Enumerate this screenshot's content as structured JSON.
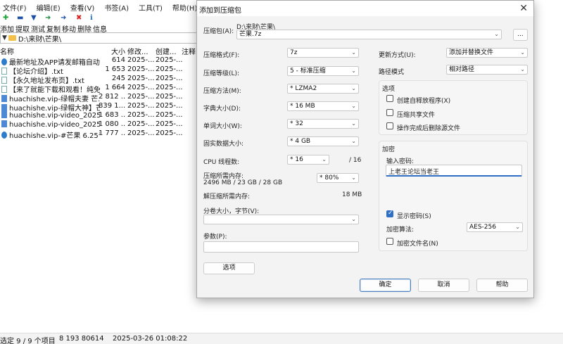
{
  "menu": [
    "文件(F)",
    "编辑(E)",
    "查看(V)",
    "书签(A)",
    "工具(T)",
    "帮助(H)"
  ],
  "toolbar": {
    "labels": [
      "添加",
      "提取",
      "测试",
      "复制",
      "移动",
      "删除",
      "信息"
    ],
    "icons": [
      "plus-icon",
      "minus-icon",
      "check-icon",
      "copy-arrow-icon",
      "move-arrow-icon",
      "delete-x-icon",
      "info-icon"
    ],
    "icon_glyphs": [
      "✚",
      "▬",
      "▼",
      "➜",
      "➜",
      "✖",
      "ℹ"
    ],
    "icon_colors": [
      "#22a33a",
      "#1d4fa8",
      "#1d4fa8",
      "#1a8a3a",
      "#1d4fa8",
      "#d22",
      "#1d6fc9"
    ]
  },
  "address": {
    "path": "D:\\来财\\芒果\\"
  },
  "file_list": {
    "headers": [
      "名称",
      "大小",
      "修改...",
      "创建...",
      "注释"
    ],
    "rows": [
      {
        "name": "最新地址及APP请发邮箱自动...",
        "size": "614",
        "modified": "2025-...",
        "created": "2025-...",
        "type": "exe"
      },
      {
        "name": "【论坛介绍】.txt",
        "size": "1 653",
        "modified": "2025-...",
        "created": "2025-...",
        "type": "txt"
      },
      {
        "name": "【永久地址发布页】.txt",
        "size": "245",
        "modified": "2025-...",
        "created": "2025-...",
        "type": "txt"
      },
      {
        "name": "【来了就能下载和观看！纯免...",
        "size": "1 664",
        "modified": "2025-...",
        "created": "2025-...",
        "type": "txt"
      },
      {
        "name": "huachishe.vip-绿帽夫妻 芒...",
        "size": "2 812 ...",
        "modified": "2025-...",
        "created": "2025-...",
        "type": "vid"
      },
      {
        "name": "huachishe.vip-绿帽大神】芒...",
        "size": "839 1...",
        "modified": "2025-...",
        "created": "2025-...",
        "type": "vid"
      },
      {
        "name": "huachishe.vip-video_2025-...",
        "size": "1 683 ...",
        "modified": "2025-...",
        "created": "2025-...",
        "type": "vid"
      },
      {
        "name": "huachishe.vip-video_2025-...",
        "size": "1 080 ...",
        "modified": "2025-...",
        "created": "2025-...",
        "type": "vid"
      },
      {
        "name": "huachishe.vip-#芒果 6.25号 ...",
        "size": "1 777 ...",
        "modified": "2025-...",
        "created": "2025-...",
        "type": "exe"
      }
    ]
  },
  "status": {
    "selected": "选定 9 / 9 个项目",
    "size": "8 193 80614",
    "datetime": "2025-03-26 01:08:22"
  },
  "dialog": {
    "title": "添加到压缩包",
    "archive_label": "压缩包(A):",
    "archive_path": "D:\\来财\\芒果\\",
    "archive_name": "芒果.7z",
    "browse_label": "...",
    "format_label": "压缩格式(F):",
    "format_value": "7z",
    "level_label": "压缩等级(L):",
    "level_value": "5 - 标准压缩",
    "method_label": "压缩方法(M):",
    "method_value": "*  LZMA2",
    "dict_label": "字典大小(D):",
    "dict_value": "*  16 MB",
    "word_label": "单词大小(W):",
    "word_value": "*  32",
    "solid_label": "固实数据大小:",
    "solid_value": "*  4 GB",
    "threads_label": "CPU 线程数:",
    "threads_value": "*  16",
    "threads_total": "/ 16",
    "mem_comp_label": "压缩所需内存:",
    "mem_comp_value": "2496 MB / 23 GB / 28 GB",
    "mem_comp_percent": "* 80%",
    "mem_decomp_label": "解压缩所需内存:",
    "mem_decomp_value": "18 MB",
    "split_label": "分卷大小，字节(V):",
    "params_label": "参数(P):",
    "options_button": "选项",
    "update_label": "更新方式(U):",
    "update_value": "添加并替换文件",
    "path_label": "路径模式",
    "path_value": "相对路径",
    "options_group": "选项",
    "opt_sfx": "创建自释放程序(X)",
    "opt_shared": "压缩共享文件",
    "opt_delete": "操作完成后删除源文件",
    "encrypt_group": "加密",
    "password_label": "输入密码:",
    "password_value": "上老王论坛当老王",
    "show_password": "显示密码(S)",
    "enc_method_label": "加密算法:",
    "enc_method_value": "AES-256",
    "encrypt_names": "加密文件名(N)",
    "ok": "确定",
    "cancel": "取消",
    "help": "帮助"
  }
}
